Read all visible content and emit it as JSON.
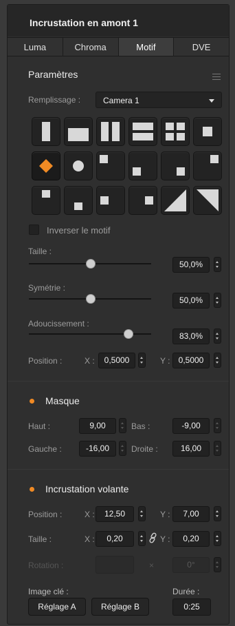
{
  "panel": {
    "title": "Incrustation en amont 1",
    "tabs": [
      {
        "label": "Luma",
        "active": false
      },
      {
        "label": "Chroma",
        "active": false
      },
      {
        "label": "Motif",
        "active": true
      },
      {
        "label": "DVE",
        "active": false
      }
    ]
  },
  "params": {
    "heading": "Paramètres",
    "menu_icon": "hamburger-menu-icon",
    "fill_label": "Remplissage :",
    "fill_value": "Camera 1",
    "patterns_selected": "diamond-iris",
    "invert_label": "Inverser le motif",
    "invert_checked": false,
    "size_label": "Taille :",
    "size_value": "50,0%",
    "size_level": 0.5,
    "symmetry_label": "Symétrie :",
    "symmetry_value": "50,0%",
    "symmetry_level": 0.5,
    "softness_label": "Adoucissement :",
    "softness_value": "83,0%",
    "softness_level": 0.83,
    "position_label": "Position :",
    "x_label": "X :",
    "y_label": "Y :",
    "pos_x": "0,5000",
    "pos_y": "0,5000"
  },
  "mask": {
    "heading": "Masque",
    "enabled": true,
    "accent": "#f08a24",
    "top_label": "Haut :",
    "top_value": "9,00",
    "bottom_label": "Bas :",
    "bottom_value": "-9,00",
    "left_label": "Gauche :",
    "left_value": "-16,00",
    "right_label": "Droite :",
    "right_value": "16,00"
  },
  "flying": {
    "heading": "Incrustation volante",
    "enabled": true,
    "position_label": "Position :",
    "x_label": "X :",
    "y_label": "Y :",
    "pos_x": "12,50",
    "pos_y": "7,00",
    "size_label": "Taille :",
    "size_x": "0,20",
    "size_y": "0,20",
    "link_icon": "chain-link-icon",
    "rotation_label": "Rotation :",
    "rotation_sep": "×",
    "rotation_value": "0°",
    "keyframe_label": "Image clé :",
    "duration_label": "Durée :",
    "set_a": "Réglage A",
    "set_b": "Réglage B",
    "duration_value": "0:25"
  }
}
